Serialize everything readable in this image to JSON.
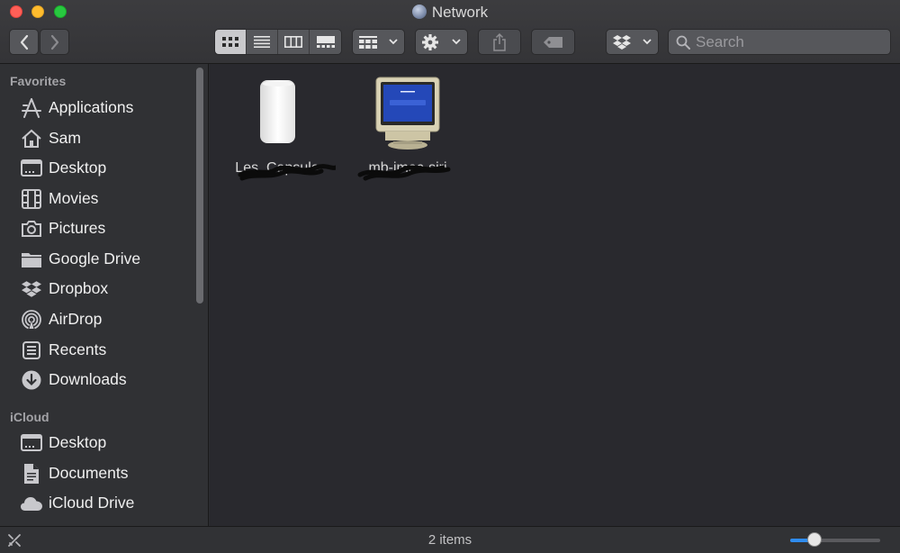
{
  "window": {
    "title": "Network"
  },
  "toolbar": {
    "search_placeholder": "Search",
    "icons": {
      "back": "chevron-left-icon",
      "forward": "chevron-right-icon",
      "views": [
        "icon-view-icon",
        "list-view-icon",
        "column-view-icon",
        "gallery-view-icon"
      ],
      "group": "group-icon",
      "action": "gear-icon",
      "share": "share-icon",
      "tag": "tag-icon",
      "dropbox": "dropbox-icon",
      "search": "search-icon"
    },
    "active_view": 0
  },
  "sidebar": {
    "favorites_title": "Favorites",
    "favorites": [
      {
        "label": "Applications",
        "icon": "applications-icon"
      },
      {
        "label": "Sam",
        "icon": "home-icon"
      },
      {
        "label": "Desktop",
        "icon": "desktop-icon"
      },
      {
        "label": "Movies",
        "icon": "movies-icon"
      },
      {
        "label": "Pictures",
        "icon": "camera-icon"
      },
      {
        "label": "Google Drive",
        "icon": "folder-icon"
      },
      {
        "label": "Dropbox",
        "icon": "dropbox-icon"
      },
      {
        "label": "AirDrop",
        "icon": "airdrop-icon"
      },
      {
        "label": "Recents",
        "icon": "recents-icon"
      },
      {
        "label": "Downloads",
        "icon": "downloads-icon"
      }
    ],
    "icloud_title": "iCloud",
    "icloud": [
      {
        "label": "Desktop",
        "icon": "desktop-icon"
      },
      {
        "label": "Documents",
        "icon": "documents-icon"
      },
      {
        "label": "iCloud Drive",
        "icon": "cloud-icon"
      }
    ]
  },
  "content": {
    "items": [
      {
        "name": "Les_Capsule",
        "icon": "airport-time-capsule-icon"
      },
      {
        "name": "mb-imac-siri",
        "icon": "crt-monitor-icon"
      }
    ]
  },
  "statusbar": {
    "count": "2 items",
    "zoom": 0.27,
    "accent": "#2f8cf0"
  }
}
